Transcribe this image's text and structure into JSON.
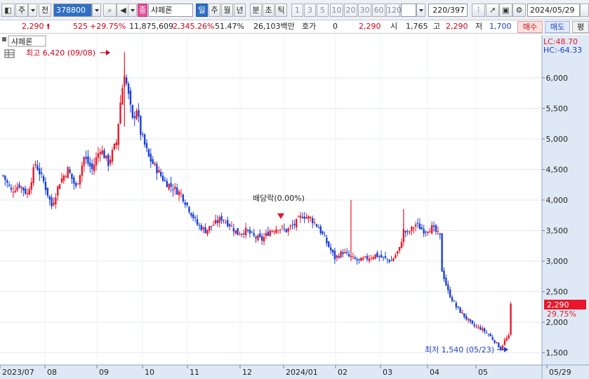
{
  "toolbar": {
    "market_label": "주",
    "jeon_label": "전",
    "code": "378800",
    "stock_badge": "종",
    "stock_name": "샤페론",
    "periods": [
      "일",
      "주",
      "월",
      "년",
      "분",
      "초",
      "틱"
    ],
    "selected_period": "일",
    "intervals": [
      "1",
      "3",
      "5",
      "10",
      "20",
      "30",
      "60",
      "120"
    ],
    "count": "220/397",
    "date": "2024/05/29"
  },
  "quote": {
    "price": "2,290",
    "change": "525",
    "change_pct": "+29.75%",
    "volume": "11,875,609",
    "volume_pct": "2,345.26%",
    "rotation": "51.47%",
    "amount": "26,103백만",
    "hoga_label": "호가",
    "hoga_value": "0",
    "hoga_price": "2,290",
    "open_label": "시",
    "open": "1,765",
    "high_label": "고",
    "high": "2,290",
    "low_label": "저",
    "low": "1,700",
    "buy_label": "매수",
    "sell_label": "매도",
    "eval_label": "평"
  },
  "chart": {
    "name_tag": "샤페론",
    "lc": "LC:48.70",
    "hc": "HC:-64.33",
    "high_marker": "최고 6,420 (09/08)",
    "low_marker": "최저 1,540 (05/23)",
    "dividend_marker": "배당락(0.00%)",
    "last_price": "2,290",
    "last_pct": "29.75%",
    "colors": {
      "up": "#e8182a",
      "down": "#1a3fd6",
      "price_tag": "#e8182a",
      "axis_bg": "#dfe9f6"
    }
  },
  "chart_data": {
    "type": "candlestick",
    "ylim": [
      1300,
      6700
    ],
    "y_ticks": [
      "1,500",
      "2,000",
      "2,500",
      "3,000",
      "3,500",
      "4,000",
      "4,500",
      "5,000",
      "5,500",
      "6,000"
    ],
    "x_ticks": [
      "2023/07",
      "08",
      "09",
      "10",
      "11",
      "12",
      "2024/01",
      "02",
      "03",
      "04",
      "05",
      "05/29"
    ],
    "close_path": [
      [
        0,
        4400
      ],
      [
        4,
        4150
      ],
      [
        8,
        4250
      ],
      [
        12,
        4100
      ],
      [
        16,
        4600
      ],
      [
        20,
        4300
      ],
      [
        24,
        3900
      ],
      [
        28,
        4300
      ],
      [
        32,
        4500
      ],
      [
        36,
        4200
      ],
      [
        40,
        4700
      ],
      [
        44,
        4500
      ],
      [
        48,
        4850
      ],
      [
        52,
        4600
      ],
      [
        56,
        4950
      ],
      [
        58,
        5600
      ],
      [
        60,
        6100
      ],
      [
        62,
        5700
      ],
      [
        64,
        5300
      ],
      [
        66,
        5500
      ],
      [
        68,
        5100
      ],
      [
        72,
        4700
      ],
      [
        76,
        4500
      ],
      [
        80,
        4300
      ],
      [
        84,
        4200
      ],
      [
        88,
        4100
      ],
      [
        92,
        3850
      ],
      [
        96,
        3600
      ],
      [
        100,
        3500
      ],
      [
        104,
        3600
      ],
      [
        108,
        3700
      ],
      [
        112,
        3600
      ],
      [
        116,
        3450
      ],
      [
        120,
        3500
      ],
      [
        124,
        3400
      ],
      [
        128,
        3350
      ],
      [
        132,
        3500
      ],
      [
        136,
        3550
      ],
      [
        140,
        3500
      ],
      [
        144,
        3600
      ],
      [
        148,
        3750
      ],
      [
        152,
        3700
      ],
      [
        156,
        3550
      ],
      [
        160,
        3300
      ],
      [
        164,
        3050
      ],
      [
        168,
        3150
      ],
      [
        172,
        3050
      ],
      [
        176,
        3000
      ],
      [
        180,
        3050
      ],
      [
        184,
        3100
      ],
      [
        188,
        3050
      ],
      [
        192,
        3000
      ],
      [
        196,
        3200
      ],
      [
        198,
        3500
      ],
      [
        200,
        3450
      ],
      [
        204,
        3600
      ],
      [
        208,
        3500
      ],
      [
        212,
        3550
      ],
      [
        216,
        3400
      ],
      [
        217,
        2850
      ],
      [
        220,
        2500
      ],
      [
        224,
        2250
      ],
      [
        228,
        2100
      ],
      [
        232,
        1950
      ],
      [
        236,
        1900
      ],
      [
        240,
        1800
      ],
      [
        244,
        1650
      ],
      [
        246,
        1560
      ],
      [
        248,
        1700
      ],
      [
        250,
        1765
      ],
      [
        251,
        2290
      ]
    ],
    "gain_pct": "+29.75%"
  }
}
